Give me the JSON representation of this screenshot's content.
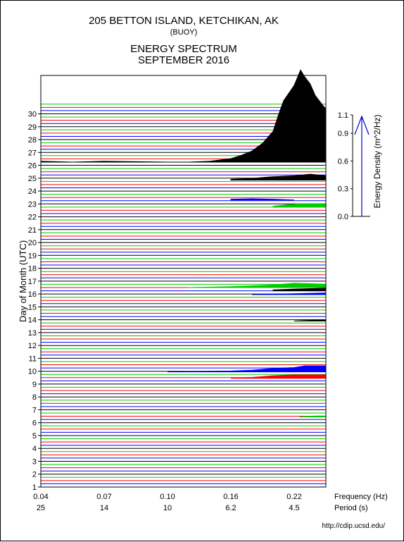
{
  "header": {
    "station": "205 BETTON ISLAND, KETCHIKAN, AK",
    "type": "(BUOY)",
    "chart_title": "ENERGY SPECTRUM",
    "date": "SEPTEMBER 2016"
  },
  "footer": {
    "url": "http://cdip.ucsd.edu/"
  },
  "chart_data": {
    "type": "area",
    "title": "ENERGY SPECTRUM",
    "xlabel": "Frequency (Hz)",
    "xlabel2": "Period (s)",
    "ylabel": "Day of Month (UTC)",
    "xlim": [
      0.04,
      0.25
    ],
    "x_ticks": [
      "0.04",
      "0.07",
      "0.10",
      "0.16",
      "0.22"
    ],
    "x_tick_values": [
      0.04,
      0.07,
      0.1,
      0.16,
      0.22
    ],
    "period_ticks": [
      "25",
      "14",
      "10",
      "6.2",
      "4.5"
    ],
    "ylim": [
      1,
      31
    ],
    "y_ticks": [
      "1",
      "2",
      "3",
      "4",
      "5",
      "6",
      "7",
      "8",
      "9",
      "10",
      "11",
      "12",
      "13",
      "14",
      "15",
      "16",
      "17",
      "18",
      "19",
      "20",
      "21",
      "22",
      "23",
      "24",
      "25",
      "26",
      "27",
      "28",
      "29",
      "30"
    ],
    "scale": {
      "label": "Energy Density (m^2/Hz)",
      "ticks": [
        "1.1",
        "0.9",
        "0.6",
        "0.3",
        "0.0"
      ],
      "tick_values": [
        1.1,
        0.9,
        0.6,
        0.3,
        0.0
      ]
    },
    "colors": {
      "night": "#000000",
      "h6": "#0000ff",
      "noon": "#ff0000",
      "h18": "#00cc00"
    },
    "series": [
      {
        "day": 26.25,
        "color": "#000000",
        "x": [
          0.04,
          0.055,
          0.07,
          0.1,
          0.12,
          0.14,
          0.16,
          0.17,
          0.18,
          0.19,
          0.2,
          0.205,
          0.21,
          0.22,
          0.226,
          0.23,
          0.235,
          0.24,
          0.25
        ],
        "values": [
          0.01,
          0.0,
          0.01,
          0.0,
          0.0,
          0.01,
          0.04,
          0.08,
          0.13,
          0.22,
          0.36,
          0.55,
          0.72,
          0.9,
          1.08,
          1.0,
          0.92,
          0.78,
          0.62
        ]
      },
      {
        "day": 24.85,
        "color": "#000000",
        "x": [
          0.16,
          0.18,
          0.2,
          0.22,
          0.235,
          0.25
        ],
        "values": [
          0.01,
          0.02,
          0.04,
          0.05,
          0.07,
          0.05
        ]
      },
      {
        "day": 22.75,
        "color": "#00cc00",
        "x": [
          0.2,
          0.215,
          0.23,
          0.25
        ],
        "values": [
          0.01,
          0.03,
          0.04,
          0.04
        ]
      },
      {
        "day": 23.3,
        "color": "#0000ff",
        "x": [
          0.16,
          0.18,
          0.2,
          0.22
        ],
        "values": [
          0.01,
          0.015,
          0.01,
          0.0
        ]
      },
      {
        "day": 16.5,
        "color": "#00cc00",
        "x": [
          0.12,
          0.16,
          0.2,
          0.22,
          0.25
        ],
        "values": [
          0.0,
          0.01,
          0.03,
          0.05,
          0.04
        ]
      },
      {
        "day": 16.25,
        "color": "#000000",
        "x": [
          0.2,
          0.22,
          0.25
        ],
        "values": [
          0.01,
          0.02,
          0.03
        ]
      },
      {
        "day": 15.95,
        "color": "#0000ff",
        "x": [
          0.18,
          0.22,
          0.25
        ],
        "values": [
          0.0,
          0.01,
          0.02
        ]
      },
      {
        "day": 13.9,
        "color": "#000000",
        "x": [
          0.22,
          0.24,
          0.25
        ],
        "values": [
          0.0,
          0.01,
          0.01
        ]
      },
      {
        "day": 9.95,
        "color": "#0000ff",
        "x": [
          0.1,
          0.16,
          0.18,
          0.2,
          0.22,
          0.23,
          0.25
        ],
        "values": [
          0.0,
          0.01,
          0.02,
          0.04,
          0.05,
          0.07,
          0.07
        ]
      },
      {
        "day": 9.45,
        "color": "#ff0000",
        "x": [
          0.16,
          0.18,
          0.2,
          0.22,
          0.25
        ],
        "values": [
          0.0,
          0.01,
          0.03,
          0.04,
          0.04
        ]
      },
      {
        "day": 6.45,
        "color": "#00cc00",
        "x": [
          0.225,
          0.24,
          0.25
        ],
        "values": [
          0.0,
          0.01,
          0.01
        ]
      }
    ]
  }
}
